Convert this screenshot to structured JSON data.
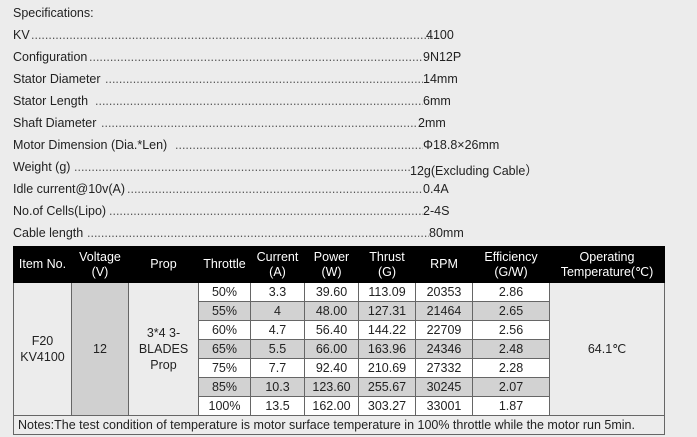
{
  "specs": {
    "title": "Specifications:",
    "rows": [
      {
        "label": "KV",
        "value": "4100"
      },
      {
        "label": "Configuration",
        "value": "9N12P"
      },
      {
        "label": "Stator Diameter",
        "value": "14mm"
      },
      {
        "label": "Stator Length",
        "value": "6mm"
      },
      {
        "label": "Shaft Diameter",
        "value": "2mm"
      },
      {
        "label": "Motor Dimension (Dia.*Len)",
        "value": "Φ18.8×26mm"
      },
      {
        "label": "Weight (g)",
        "value": "12g(Excluding Cable）"
      },
      {
        "label": "Idle current@10v(A)",
        "value": "0.4A"
      },
      {
        "label": "No.of Cells(Lipo)",
        "value": "2-4S"
      },
      {
        "label": "Cable length",
        "value": "80mm"
      }
    ]
  },
  "table": {
    "headers": {
      "item": "Item No.",
      "voltage": "Voltage (V)",
      "prop": "Prop",
      "throttle": "Throttle",
      "current": "Current (A)",
      "power": "Power (W)",
      "thrust": "Thrust (G)",
      "rpm": "RPM",
      "efficiency": "Efficiency (G/W)",
      "temp": "Operating Temperature(℃)"
    },
    "item_no": "F20 KV4100",
    "voltage": "12",
    "prop": "3*4 3-BLADES Prop",
    "temperature": "64.1℃",
    "rows": [
      {
        "throttle": "50%",
        "current": "3.3",
        "power": "39.60",
        "thrust": "113.09",
        "rpm": "20353",
        "efficiency": "2.86"
      },
      {
        "throttle": "55%",
        "current": "4",
        "power": "48.00",
        "thrust": "127.31",
        "rpm": "21464",
        "efficiency": "2.65"
      },
      {
        "throttle": "60%",
        "current": "4.7",
        "power": "56.40",
        "thrust": "144.22",
        "rpm": "22709",
        "efficiency": "2.56"
      },
      {
        "throttle": "65%",
        "current": "5.5",
        "power": "66.00",
        "thrust": "163.96",
        "rpm": "24346",
        "efficiency": "2.48"
      },
      {
        "throttle": "75%",
        "current": "7.7",
        "power": "92.40",
        "thrust": "210.69",
        "rpm": "27332",
        "efficiency": "2.28"
      },
      {
        "throttle": "85%",
        "current": "10.3",
        "power": "123.60",
        "thrust": "255.67",
        "rpm": "30245",
        "efficiency": "2.07"
      },
      {
        "throttle": "100%",
        "current": "13.5",
        "power": "162.00",
        "thrust": "303.27",
        "rpm": "33001",
        "efficiency": "1.87"
      }
    ],
    "note": "Notes:The test condition of temperature is motor surface temperature in 100% throttle while the motor run 5min."
  }
}
